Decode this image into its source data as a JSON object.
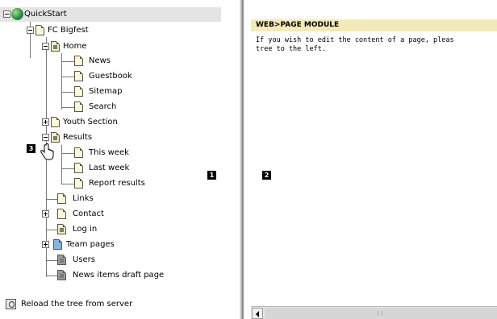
{
  "tree": {
    "root_label": "QuickStart",
    "items": [
      {
        "label": "FC Bigfest"
      },
      {
        "label": "Home"
      },
      {
        "label": "News"
      },
      {
        "label": "Guestbook"
      },
      {
        "label": "Sitemap"
      },
      {
        "label": "Search"
      },
      {
        "label": "Youth Section"
      },
      {
        "label": "Results"
      },
      {
        "label": "This week"
      },
      {
        "label": "Last week"
      },
      {
        "label": "Report results"
      },
      {
        "label": "Links"
      },
      {
        "label": "Contact"
      },
      {
        "label": "Log in"
      },
      {
        "label": "Team pages"
      },
      {
        "label": "Users"
      },
      {
        "label": "News items draft page"
      }
    ],
    "reload_label": "Reload the tree from server"
  },
  "markers": {
    "m1": "1",
    "m2": "2",
    "m3": "3"
  },
  "module": {
    "header": "WEB>PAGE MODULE",
    "line1": "If you wish to edit the content of a page, pleas",
    "line2": "tree to the left."
  },
  "icons": [
    "globe-icon",
    "page-icon",
    "expand-icon",
    "collapse-icon",
    "hand-cursor-icon",
    "reload-icon",
    "scroll-left-icon"
  ],
  "colors": {
    "module_header_bg": "#f4e9b8",
    "selected_row_bg": "#e4e4e4"
  }
}
